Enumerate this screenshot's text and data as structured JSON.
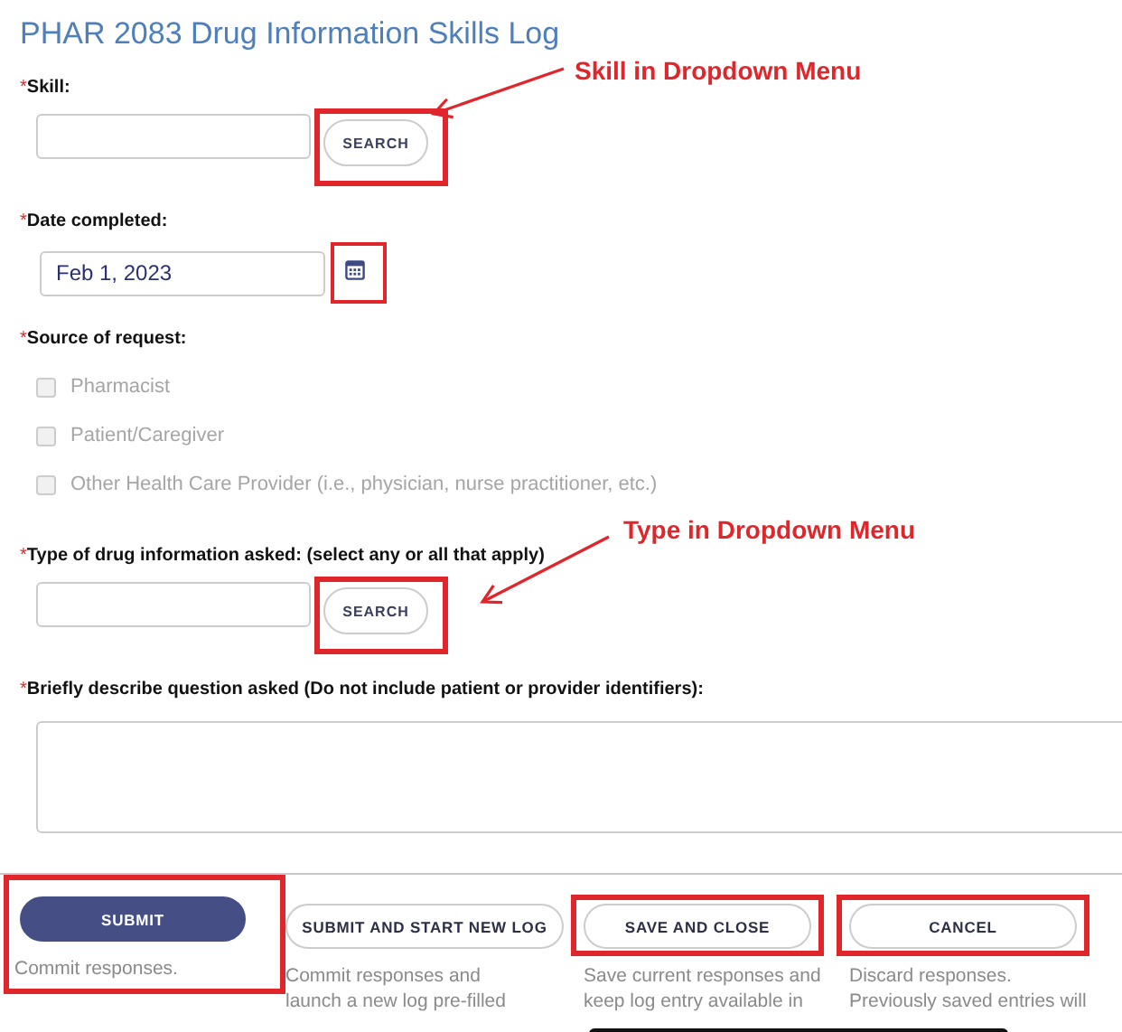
{
  "title": "PHAR 2083 Drug Information Skills Log",
  "fields": [
    {
      "kind": "search",
      "marker": "*",
      "label": "Skill:",
      "button": "SEARCH",
      "highlighted": true,
      "annotation": "Skill in Dropdown Menu"
    },
    {
      "kind": "date",
      "marker": "*",
      "label": "Date completed:",
      "value": "Feb 1, 2023",
      "highlighted": true
    },
    {
      "kind": "checkboxes",
      "marker": "*",
      "label": "Source of request:",
      "options": [
        {
          "label": "Pharmacist",
          "checked": false,
          "disabled": true
        },
        {
          "label": "Patient/Caregiver",
          "checked": false,
          "disabled": true
        },
        {
          "label": "Other Health Care Provider (i.e., physician, nurse practitioner, etc.)",
          "checked": false,
          "disabled": true
        }
      ]
    },
    {
      "kind": "search",
      "marker": "*",
      "label": "Type of drug information asked: (select any or all that apply)",
      "button": "SEARCH",
      "highlighted": true,
      "annotation": "Type in Dropdown Menu"
    },
    {
      "kind": "textarea",
      "marker": "*",
      "label": "Briefly describe question asked (Do not include patient or provider identifiers):"
    }
  ],
  "actions": [
    {
      "label": "SUBMIT",
      "primary": true,
      "highlighted": true,
      "highlight_includes_description": true,
      "description": "Commit responses."
    },
    {
      "label": "SUBMIT AND START NEW LOG",
      "primary": false,
      "highlighted": false,
      "highlight_includes_description": false,
      "description": "Commit responses and launch a new log pre-filled"
    },
    {
      "label": "SAVE AND CLOSE",
      "primary": false,
      "highlighted": true,
      "highlight_includes_description": false,
      "description": "Save current responses and keep log entry available in"
    },
    {
      "label": "CANCEL",
      "primary": false,
      "highlighted": true,
      "highlight_includes_description": false,
      "description": "Discard responses. Previously saved entries will"
    }
  ]
}
